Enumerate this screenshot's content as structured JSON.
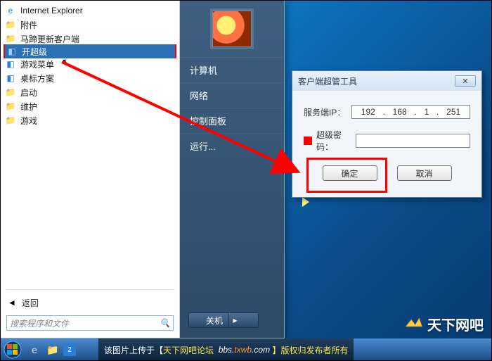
{
  "start_menu": {
    "programs": [
      {
        "label": "Internet Explorer",
        "icon": "ie"
      },
      {
        "label": "附件",
        "icon": "folder"
      },
      {
        "label": "马蹄更新客户端",
        "icon": "folder"
      },
      {
        "label": "开超级",
        "icon": "app-blue",
        "highlighted": true
      },
      {
        "label": "游戏菜单",
        "icon": "app-blue"
      },
      {
        "label": "桌标方案",
        "icon": "app-blue"
      },
      {
        "label": "启动",
        "icon": "folder"
      },
      {
        "label": "维护",
        "icon": "folder"
      },
      {
        "label": "游戏",
        "icon": "folder"
      }
    ],
    "back_label": "返回",
    "search_placeholder": "搜索程序和文件",
    "right_links": [
      "计算机",
      "网络",
      "控制面板",
      "运行..."
    ],
    "shutdown_label": "关机"
  },
  "dialog": {
    "title": "客户端超管工具",
    "ip_label": "服务端IP：",
    "ip_parts": [
      "192",
      "168",
      "1",
      "251"
    ],
    "pw_label": "超级密码：",
    "ok_label": "确定",
    "cancel_label": "取消"
  },
  "brand": {
    "text": "天下网吧"
  },
  "watermark": {
    "prefix": "该图片上传于【",
    "site_cn": "天下网吧论坛",
    "site_url_1": "bbs.",
    "site_url_2": "txwb",
    "site_url_3": ".com",
    "suffix": "】版权归发布者所有"
  }
}
